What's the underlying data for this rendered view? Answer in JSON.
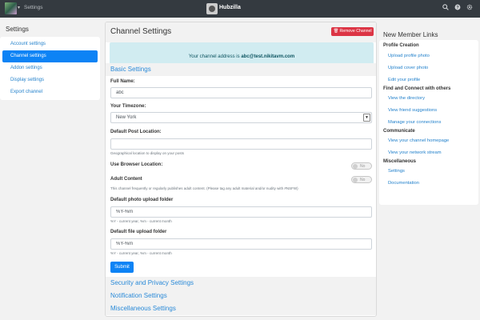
{
  "topnav": {
    "section_label": "Settings",
    "brand_name": "Hubzilla",
    "icons": [
      "search-icon",
      "help-icon",
      "gear-icon"
    ]
  },
  "left_sidebar": {
    "heading": "Settings",
    "items": [
      {
        "label": "Account settings",
        "active": false
      },
      {
        "label": "Channel settings",
        "active": true
      },
      {
        "label": "Addon settings",
        "active": false
      },
      {
        "label": "Display settings",
        "active": false
      },
      {
        "label": "Export channel",
        "active": false
      }
    ]
  },
  "main": {
    "title": "Channel Settings",
    "remove_button": "Remove Channel",
    "address_prefix": "Your channel address is",
    "address": "abc@test.nikitavm.com",
    "basic_header": "Basic Settings",
    "full_name_label": "Full Name:",
    "full_name_value": "abc",
    "timezone_label": "Your Timezone:",
    "timezone_value": "New York",
    "post_location_label": "Default Post Location:",
    "post_location_value": "",
    "post_location_help": "Geographical location to display on your posts",
    "browser_location_label": "Use Browser Location:",
    "browser_location_toggle": "No",
    "adult_label": "Adult Content",
    "adult_toggle": "No",
    "adult_help": "This channel frequently or regularly publishes adult content. (Please tag any adult material and/or nudity with #NSFW)",
    "photo_folder_label": "Default photo upload folder",
    "photo_folder_value": "%Y-%m",
    "photo_folder_help": "%Y - current year, %m - current month",
    "file_folder_label": "Default file upload folder",
    "file_folder_value": "%Y-%m",
    "file_folder_help": "%Y - current year, %m - current month",
    "submit_label": "Submit",
    "security_header": "Security and Privacy Settings",
    "notification_header": "Notification Settings",
    "misc_header": "Miscellaneous Settings"
  },
  "right_sidebar": {
    "title": "New Member Links",
    "categories": [
      {
        "name": "Profile Creation",
        "links": [
          "Upload profile photo",
          "Upload cover photo",
          "Edit your profile"
        ]
      },
      {
        "name": "Find and Connect with others",
        "links": [
          "View the directory",
          "View friend suggestions",
          "Manage your connections"
        ]
      },
      {
        "name": "Communicate",
        "links": [
          "View your channel homepage",
          "View your network stream"
        ]
      },
      {
        "name": "Miscellaneous",
        "links": [
          "Settings",
          "Documentation"
        ]
      }
    ]
  },
  "colors": {
    "navbar": "#343a40",
    "primary": "#0d83f5",
    "danger": "#dc3545",
    "info_bg": "#d1ecf1",
    "link": "#2482cc"
  }
}
